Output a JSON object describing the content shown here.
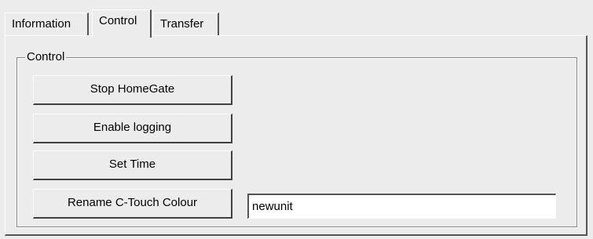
{
  "tabs": [
    {
      "label": "Information",
      "active": false
    },
    {
      "label": "Control",
      "active": true
    },
    {
      "label": "Transfer",
      "active": false
    }
  ],
  "control_group": {
    "title": "Control",
    "buttons": {
      "stop_homegate": "Stop HomeGate",
      "enable_logging": "Enable logging",
      "set_time": "Set Time",
      "rename_ctouch": "Rename C-Touch Colour"
    },
    "unit_name": {
      "value": "newunit",
      "placeholder": ""
    }
  }
}
